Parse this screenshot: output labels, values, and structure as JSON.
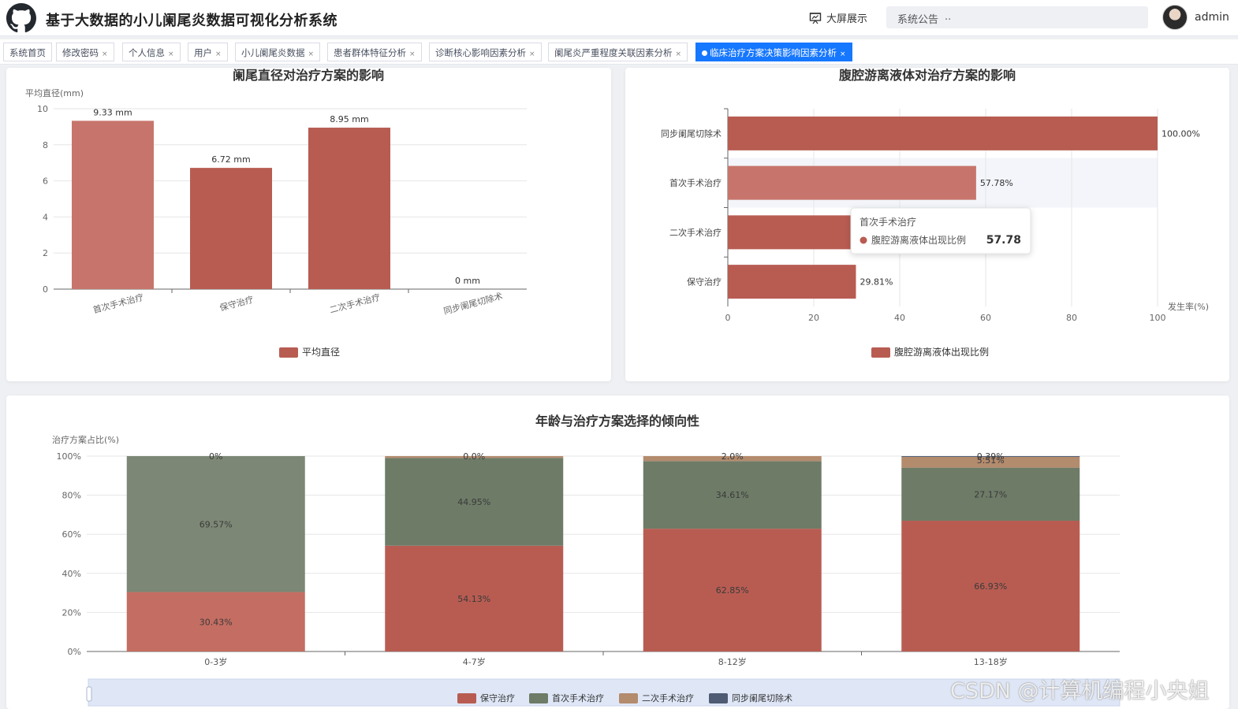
{
  "header": {
    "title": "基于大数据的小儿阑尾炎数据可视化分析系统",
    "bigscreen_label": "大屏展示",
    "notice_label": "系统公告",
    "notice_dots": "··",
    "username": "admin"
  },
  "tabs": [
    {
      "label": "系统首页",
      "closable": false,
      "active": false
    },
    {
      "label": "修改密码",
      "closable": true,
      "active": false
    },
    {
      "label": "个人信息",
      "closable": true,
      "active": false
    },
    {
      "label": "用户",
      "closable": true,
      "active": false
    },
    {
      "label": "小儿阑尾炎数据",
      "closable": true,
      "active": false
    },
    {
      "label": "患者群体特征分析",
      "closable": true,
      "active": false
    },
    {
      "label": "诊断核心影响因素分析",
      "closable": true,
      "active": false
    },
    {
      "label": "阑尾炎严重程度关联因素分析",
      "closable": true,
      "active": false
    },
    {
      "label": "临床治疗方案决策影响因素分析",
      "closable": true,
      "active": true
    }
  ],
  "tab_close_glyph": "×",
  "watermark": "CSDN @计算机编程小央姐",
  "colors": {
    "primary_tab": "#1677ff",
    "bar_red": "#b85c52",
    "bar_red_light": "#c7756c",
    "green": "#6e7b67",
    "tan": "#b38b6d",
    "navy": "#4f5b73"
  },
  "chart_data": [
    {
      "type": "bar",
      "title": "阑尾直径对治疗方案的影响",
      "ylabel": "平均直径(mm)",
      "categories": [
        "首次手术治疗",
        "保守治疗",
        "二次手术治疗",
        "同步阑尾切除术"
      ],
      "series": [
        {
          "name": "平均直径",
          "values": [
            9.33,
            6.72,
            8.95,
            0
          ]
        }
      ],
      "data_labels": [
        "9.33 mm",
        "6.72 mm",
        "8.95 mm",
        "0 mm"
      ],
      "ylim": [
        0,
        10
      ],
      "yticks": [
        0,
        2,
        4,
        6,
        8,
        10
      ],
      "legend": "bottom-center",
      "grid": true
    },
    {
      "type": "bar",
      "orientation": "horizontal",
      "title": "腹腔游离液体对治疗方案的影响",
      "xlabel": "发生率(%)",
      "categories": [
        "同步阑尾切除术",
        "首次手术治疗",
        "二次手术治疗",
        "保守治疗"
      ],
      "series": [
        {
          "name": "腹腔游离液体出现比例",
          "values": [
            100.0,
            57.78,
            29.81,
            29.81
          ]
        }
      ],
      "data_labels": [
        "100.00%",
        "57.78%",
        "",
        "29.81%"
      ],
      "xlim": [
        0,
        100
      ],
      "xticks": [
        0,
        20,
        40,
        60,
        80,
        100
      ],
      "legend": "bottom-center",
      "grid": true,
      "tooltip": {
        "title": "首次手术治疗",
        "series": "腹腔游离液体出现比例",
        "value": "57.78"
      }
    },
    {
      "type": "bar",
      "stacked": true,
      "title": "年龄与治疗方案选择的倾向性",
      "ylabel": "治疗方案占比(%)",
      "categories": [
        "0-3岁",
        "4-7岁",
        "8-12岁",
        "13-18岁"
      ],
      "series": [
        {
          "name": "保守治疗",
          "values": [
            30.43,
            54.13,
            62.85,
            66.93
          ],
          "labels": [
            "30.43%",
            "54.13%",
            "62.85%",
            "66.93%"
          ]
        },
        {
          "name": "首次手术治疗",
          "values": [
            69.57,
            44.95,
            34.61,
            27.17
          ],
          "labels": [
            "69.57%",
            "44.95%",
            "34.61%",
            "27.17%"
          ]
        },
        {
          "name": "二次手术治疗",
          "values": [
            0,
            0.92,
            2.54,
            5.51
          ],
          "labels": [
            "0%",
            "0.0%",
            "2.0%",
            "5.51%"
          ]
        },
        {
          "name": "同步阑尾切除术",
          "values": [
            0,
            0,
            0,
            0.39
          ],
          "labels": [
            "",
            "",
            "",
            "0.39%"
          ]
        }
      ],
      "ylim": [
        0,
        100
      ],
      "yticks": [
        "0%",
        "20%",
        "40%",
        "60%",
        "80%",
        "100%"
      ],
      "legend": "bottom-center",
      "grid": true,
      "datazoom": true
    }
  ]
}
